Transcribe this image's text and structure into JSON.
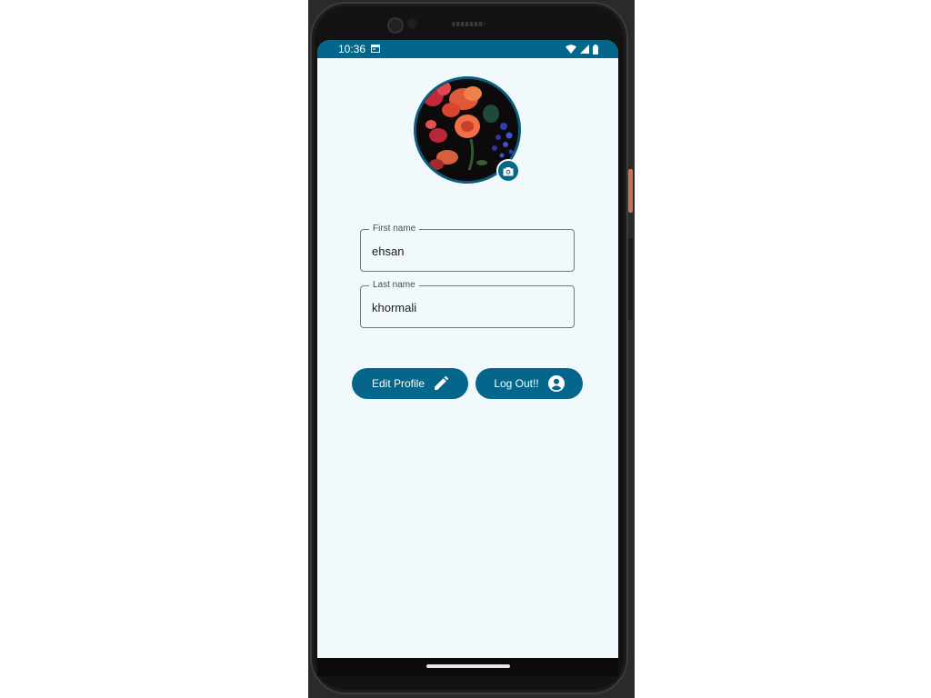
{
  "status_bar": {
    "time": "10:36",
    "icons": [
      "notification-icon",
      "wifi-icon",
      "signal-icon",
      "battery-icon"
    ]
  },
  "profile": {
    "avatar": "profile-photo",
    "change_photo_icon": "camera-icon"
  },
  "form": {
    "first_name": {
      "label": "First name",
      "value": "ehsan"
    },
    "last_name": {
      "label": "Last name",
      "value": "khormali"
    }
  },
  "actions": {
    "edit_profile": {
      "label": "Edit Profile",
      "icon": "pencil-icon"
    },
    "log_out": {
      "label": "Log Out!!",
      "icon": "account-circle-icon"
    }
  },
  "colors": {
    "primary": "#04668a",
    "background": "#f1f9fc",
    "outline": "#6f7a80"
  }
}
